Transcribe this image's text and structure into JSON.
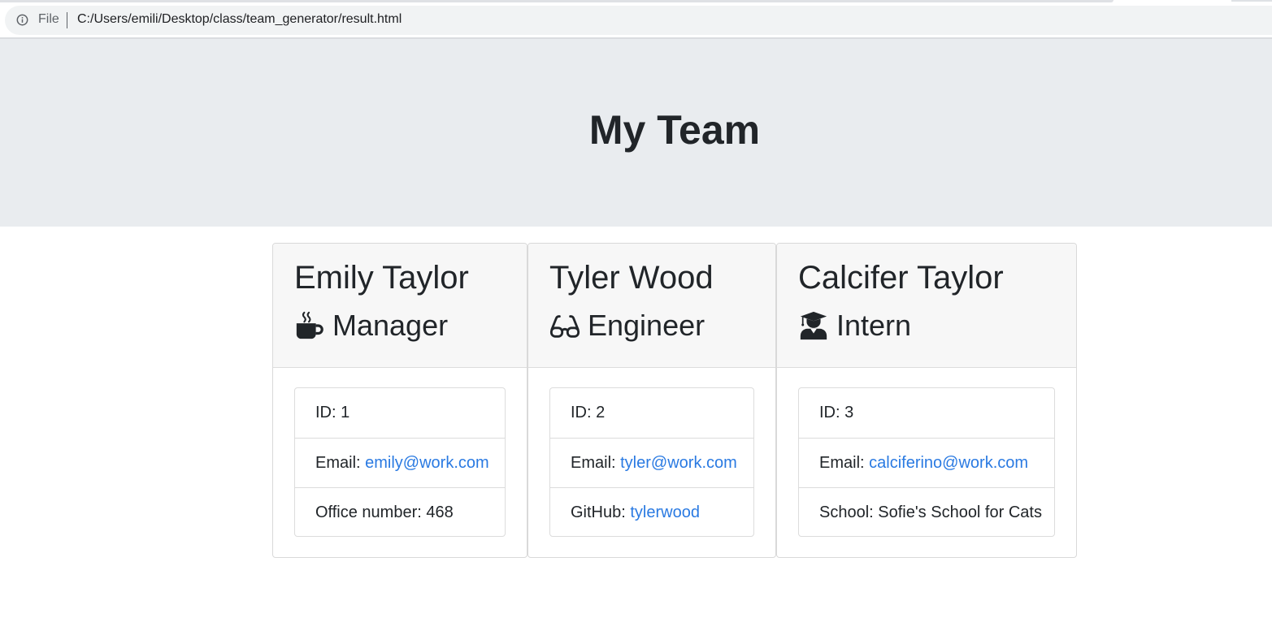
{
  "browser": {
    "scheme_label": "File",
    "url": "C:/Users/emili/Desktop/class/team_generator/result.html"
  },
  "page": {
    "title": "My Team"
  },
  "colors": {
    "link": "#2a7ae2",
    "jumbotron_bg": "#e9ecef",
    "card_header_bg": "#f7f7f7"
  },
  "cards": [
    {
      "name": "Emily Taylor",
      "role": "Manager",
      "role_icon": "mug-icon",
      "id_label": "ID: 1",
      "email_prefix": "Email: ",
      "email": "emily@work.com",
      "extra_prefix": "Office number: 468",
      "extra_link": ""
    },
    {
      "name": "Tyler Wood",
      "role": "Engineer",
      "role_icon": "glasses-icon",
      "id_label": "ID: 2",
      "email_prefix": "Email: ",
      "email": "tyler@work.com",
      "extra_prefix": "GitHub: ",
      "extra_link": "tylerwood"
    },
    {
      "name": "Calcifer Taylor",
      "role": "Intern",
      "role_icon": "graduate-icon",
      "id_label": "ID: 3",
      "email_prefix": "Email: ",
      "email": "calciferino@work.com",
      "extra_prefix": "School: Sofie's School for Cats",
      "extra_link": ""
    }
  ]
}
